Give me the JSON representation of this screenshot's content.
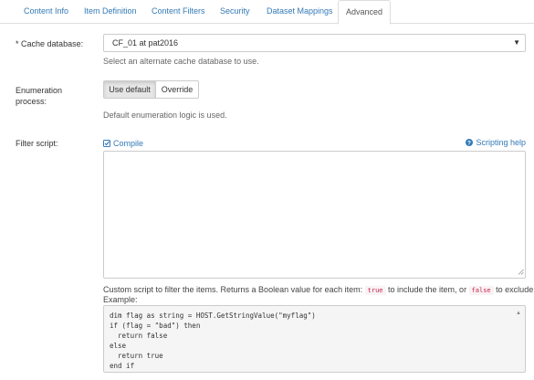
{
  "tabs": [
    {
      "label": "Content Info"
    },
    {
      "label": "Item Definition"
    },
    {
      "label": "Content Filters"
    },
    {
      "label": "Security"
    },
    {
      "label": "Dataset Mappings"
    },
    {
      "label": "Advanced",
      "active": true
    }
  ],
  "cache": {
    "label_marker": "*",
    "label": "Cache database:",
    "value": "CF_01 at pat2016",
    "help": "Select an alternate cache database to use."
  },
  "enumeration": {
    "label": "Enumeration process:",
    "use_default": "Use default",
    "override": "Override",
    "help": "Default enumeration logic is used."
  },
  "filter": {
    "label": "Filter script:",
    "compile": "Compile",
    "scripting_help": "Scripting help",
    "script_value": "",
    "help_prefix": "Custom script to filter the items. Returns a Boolean value for each item:",
    "true_token": "true",
    "help_middle": "to include the item, or",
    "false_token": "false",
    "help_suffix": "to exclude it.",
    "example_label": "Example:",
    "example_lines": [
      "dim flag as string = HOST.GetStringValue(\"myflag\")",
      "if (flag = \"bad\") then",
      "  return false",
      "else",
      "  return true",
      "end if"
    ]
  },
  "colors": {
    "link": "#337ab7",
    "active_button_bg": "#e6e6e6",
    "code_bg": "#f5f5f5",
    "inline_code_fg": "#c7254e"
  },
  "icons": {
    "compile": "check-square-icon",
    "help": "question-circle-icon",
    "dropdown": "caret-down-icon"
  }
}
